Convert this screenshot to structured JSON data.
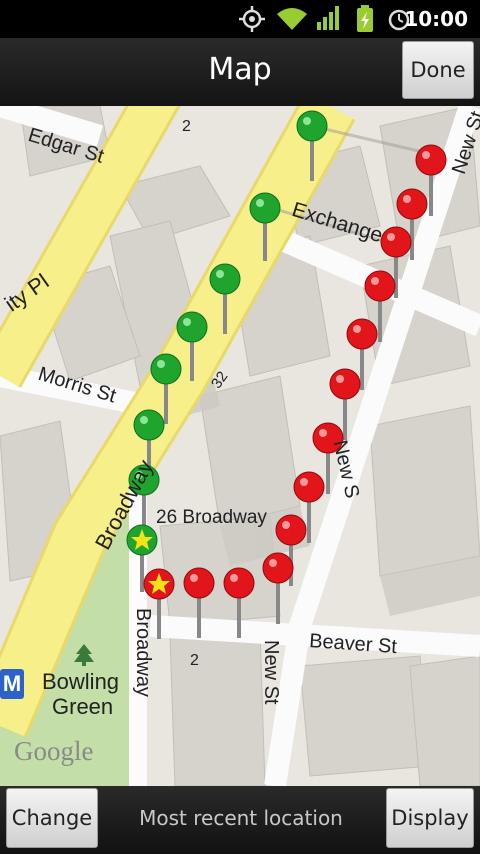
{
  "status_bar": {
    "time": "10:00",
    "icons": [
      "gps-icon",
      "wifi-icon",
      "signal-icon",
      "battery-charging-icon",
      "alarm-icon"
    ]
  },
  "header": {
    "title": "Map",
    "done_label": "Done"
  },
  "map": {
    "streets": {
      "edgar": "Edgar St",
      "exchange": "Exchange",
      "city_pl": "ity Pl",
      "morris": "Morris St",
      "broadway_upper": "Broadway",
      "broadway_lower": "Broadway",
      "beaver": "Beaver St",
      "new_st_lower": "New St",
      "new_st_upper": "New S",
      "new_st_mid": "New St"
    },
    "places": {
      "broadway_26": "26 Broadway",
      "bowling_green_1": "Bowling",
      "bowling_green_2": "Green",
      "metro": "M"
    },
    "numbers": {
      "n2_top": "2",
      "n32": "32",
      "n2_bottom": "2"
    },
    "attribution": "Google",
    "colors": {
      "green_pin": "#1fa52e",
      "red_pin": "#e2151b",
      "road_yellow": "#f7ef8a",
      "park_green": "#c4dea8"
    }
  },
  "footer": {
    "change_label": "Change",
    "status_text": "Most recent location",
    "display_label": "Display"
  }
}
